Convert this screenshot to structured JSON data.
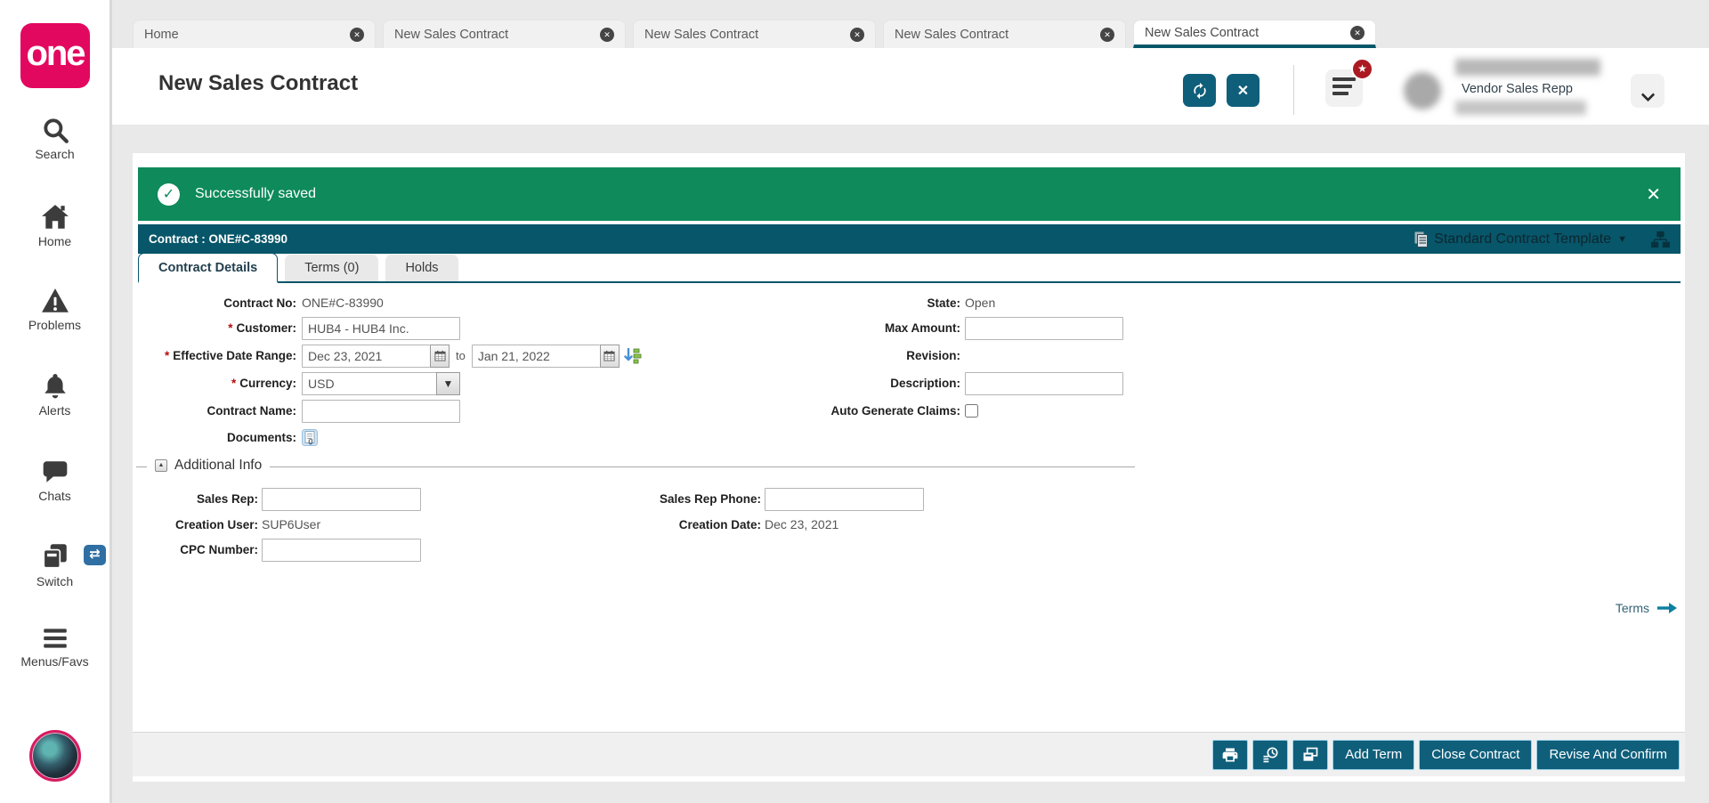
{
  "brand": {
    "logo_text": "one"
  },
  "sidebar": {
    "items": [
      {
        "label": "Search"
      },
      {
        "label": "Home"
      },
      {
        "label": "Problems"
      },
      {
        "label": "Alerts"
      },
      {
        "label": "Chats"
      },
      {
        "label": "Switch"
      },
      {
        "label": "Menus/Favs"
      }
    ]
  },
  "tabbar": {
    "tabs": [
      {
        "label": "Home",
        "active": false
      },
      {
        "label": "New Sales Contract",
        "active": false
      },
      {
        "label": "New Sales Contract",
        "active": false
      },
      {
        "label": "New Sales Contract",
        "active": false
      },
      {
        "label": "New Sales Contract",
        "active": true
      }
    ]
  },
  "header": {
    "title": "New Sales Contract",
    "user_role": "Vendor Sales Repp"
  },
  "banner": {
    "message": "Successfully saved"
  },
  "contract_bar": {
    "title": "Contract : ONE#C-83990",
    "template_label": "Standard Contract Template"
  },
  "subtabs": [
    {
      "label": "Contract Details",
      "active": true
    },
    {
      "label": "Terms (0)",
      "active": false
    },
    {
      "label": "Holds",
      "active": false
    }
  ],
  "form": {
    "required_marker": "*",
    "contract_no_label": "Contract No:",
    "contract_no_value": "ONE#C-83990",
    "state_label": "State:",
    "state_value": "Open",
    "customer_label": "Customer:",
    "customer_value": "HUB4 - HUB4 Inc.",
    "max_amount_label": "Max Amount:",
    "max_amount_value": "",
    "effective_date_range_label": "Effective Date Range:",
    "date_from_value": "Dec 23, 2021",
    "to_label": "to",
    "date_to_value": "Jan 21, 2022",
    "revision_label": "Revision:",
    "revision_value": "",
    "currency_label": "Currency:",
    "currency_value": "USD",
    "description_label": "Description:",
    "description_value": "",
    "contract_name_label": "Contract Name:",
    "contract_name_value": "",
    "auto_generate_claims_label": "Auto Generate Claims:",
    "auto_generate_claims_checked": false,
    "documents_label": "Documents:"
  },
  "additional_info": {
    "title": "Additional Info",
    "sales_rep_label": "Sales Rep:",
    "sales_rep_value": "",
    "sales_rep_phone_label": "Sales Rep Phone:",
    "sales_rep_phone_value": "",
    "creation_user_label": "Creation User:",
    "creation_user_value": "SUP6User",
    "creation_date_label": "Creation Date:",
    "creation_date_value": "Dec 23, 2021",
    "cpc_number_label": "CPC Number:",
    "cpc_number_value": ""
  },
  "terms_link": {
    "label": "Terms"
  },
  "footer": {
    "buttons": [
      {
        "label": "Add Term"
      },
      {
        "label": "Close Contract"
      },
      {
        "label": "Revise And Confirm"
      }
    ]
  },
  "icons": {
    "tab_close": "✕",
    "banner_check": "✓",
    "banner_close": "✕",
    "window_close": "✕",
    "caret_down": "▼",
    "select_caret": "▼",
    "switch_badge": "⇄",
    "favorite_star": "★",
    "collapse_up": "▲"
  },
  "colors": {
    "brand_pink": "#e3085f",
    "teal_bar": "#07566a",
    "action_button_teal": "#0f5f7b",
    "success_green": "#0e8a5b",
    "badge_red": "#ab1a22",
    "switch_badge_blue": "#2f6fa3"
  }
}
